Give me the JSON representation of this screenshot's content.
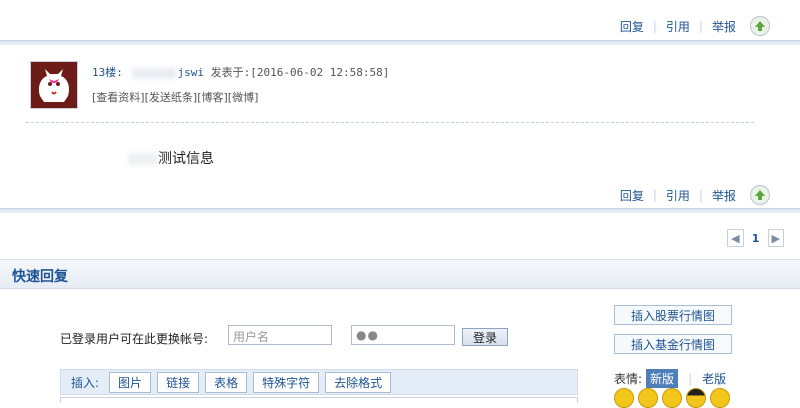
{
  "post_top_actions": {
    "reply": "回复",
    "quote": "引用",
    "report": "举报",
    "sep": "|"
  },
  "post": {
    "floor": "13楼:",
    "username": "jswi",
    "posted_label": "发表于:",
    "timestamp": "[2016-06-02 12:58:58]",
    "links": [
      "[查看资料]",
      "[发送纸条]",
      "[博客]",
      "[微博]"
    ],
    "content": "测试信息",
    "actions": {
      "reply": "回复",
      "quote": "引用",
      "report": "举报",
      "sep": "|"
    }
  },
  "pager": {
    "prev": "◀",
    "current": "1",
    "next": "▶"
  },
  "quick_reply": {
    "title": "快速回复",
    "login_label": "已登录用户可在此更换帐号:",
    "username_placeholder": "用户名",
    "password_value": "●●",
    "login_button": "登录",
    "toolbar": {
      "label": "插入:",
      "buttons": [
        "图片",
        "链接",
        "表格",
        "特殊字符",
        "去除格式"
      ]
    },
    "side": {
      "stock_button": "插入股票行情图",
      "fund_button": "插入基金行情图",
      "emoticon_label": "表情:",
      "tab_new": "新版",
      "tab_sep": "|",
      "tab_old": "老版"
    }
  },
  "colors": {
    "link": "#1e5494",
    "accent_tab": "#4e7fb9",
    "separator": "#d9e3ee"
  }
}
